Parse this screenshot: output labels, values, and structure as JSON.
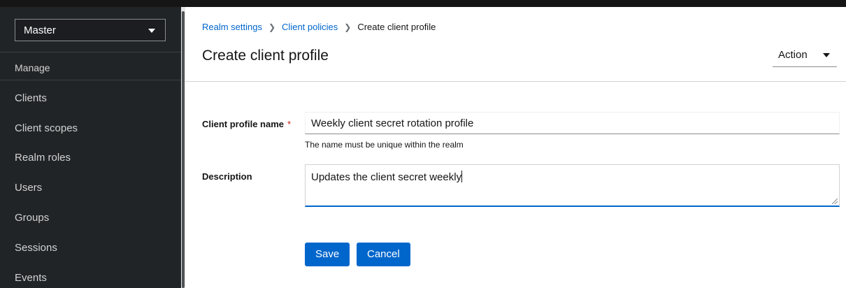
{
  "sidebar": {
    "realm_select": "Master",
    "section_heading": "Manage",
    "items": [
      {
        "label": "Clients"
      },
      {
        "label": "Client scopes"
      },
      {
        "label": "Realm roles"
      },
      {
        "label": "Users"
      },
      {
        "label": "Groups"
      },
      {
        "label": "Sessions"
      },
      {
        "label": "Events"
      }
    ]
  },
  "breadcrumb": {
    "items": [
      "Realm settings",
      "Client policies",
      "Create client profile"
    ]
  },
  "header": {
    "title": "Create client profile",
    "action_label": "Action"
  },
  "form": {
    "name_label": "Client profile name",
    "required_mark": "*",
    "name_value": "Weekly client secret rotation profile",
    "name_helper": "The name must be unique within the realm",
    "description_label": "Description",
    "description_value": "Updates the client secret weekly"
  },
  "buttons": {
    "save": "Save",
    "cancel": "Cancel"
  },
  "colors": {
    "accent": "#0066cc",
    "sidebar_bg": "#212427",
    "required": "#c9190b"
  }
}
